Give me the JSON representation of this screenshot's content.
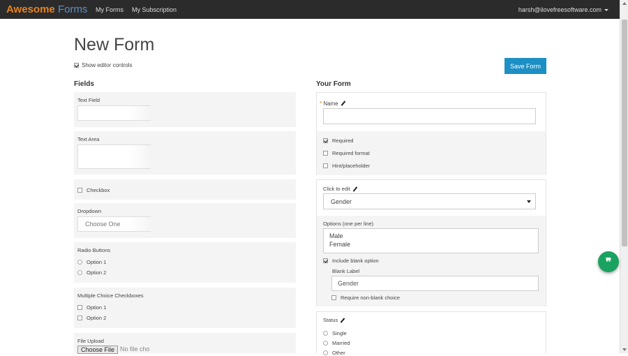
{
  "header": {
    "brand_part1": "Awesome",
    "brand_part2": "Forms",
    "nav": [
      "My Forms",
      "My Subscription"
    ],
    "user_email": "harsh@ilovefreesoftware.com"
  },
  "page": {
    "title": "New Form",
    "show_editor_controls_label": "Show editor controls",
    "save_label": "Save Form"
  },
  "fields_panel": {
    "heading": "Fields",
    "text_field": "Text Field",
    "text_area": "Text Area",
    "checkbox": "Checkbox",
    "dropdown": "Dropdown",
    "dropdown_placeholder": "Choose One",
    "radio_buttons": "Radio Buttons",
    "radio_options": [
      "Option 1",
      "Option 2"
    ],
    "multiple_choice": "Multiple Choice Checkboxes",
    "multi_options": [
      "Option 1",
      "Option 2"
    ],
    "file_upload": "File Upload",
    "choose_file": "Choose File",
    "no_file": "No file cho"
  },
  "form_panel": {
    "heading": "Your Form",
    "name_field": {
      "label": "Name",
      "required": "Required",
      "required_format": "Required format",
      "hint": "Hint/placeholder"
    },
    "dropdown_field": {
      "label": "Click to edit",
      "selected": "Gender",
      "options_label": "Options (one per line)",
      "options": [
        "Male",
        "Female"
      ],
      "include_blank": "Include blank option",
      "blank_label_title": "Blank Label",
      "blank_label_value": "Gender",
      "require_nonblank": "Require non-blank choice"
    },
    "status_field": {
      "label": "Status",
      "options": [
        "Single",
        "Married",
        "Other"
      ]
    }
  },
  "colors": {
    "accent": "#1c90c4",
    "brand_orange": "#e8821f",
    "brand_blue": "#5d8fc9",
    "fab_green": "#1aa260"
  },
  "fab_icon": "quote-icon"
}
